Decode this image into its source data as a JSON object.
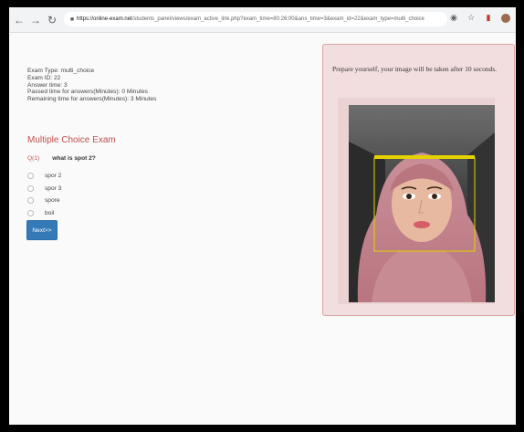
{
  "browser": {
    "url_host": "https://online-exam.net",
    "url_path": "/students_panel/views/exam_active_link.php?exam_time=80:26:00&ans_time=3&exam_id=22&exam_type=multi_choice"
  },
  "exam_info": {
    "type": "Exam Type: multi_choice",
    "id": "Exam ID: 22",
    "answer_time": "Answer time: 3",
    "passed_time": "Passed time for answers(Minutes): 0 Minutes",
    "remaining_time": "Remaining time for answers(Minutes): 3 Minutes"
  },
  "exam": {
    "title": "Multiple Choice Exam",
    "question_number": "Q(1)",
    "question_text": "what is spot 2?",
    "options": [
      "spor 2",
      "spor 3",
      "spore",
      "boil"
    ],
    "next_label": "Next>>"
  },
  "camera": {
    "message": "Prepare yourself, your image will be taken after 10 seconds."
  },
  "colors": {
    "accent": "#c0504d",
    "button": "#337ab7",
    "panel_bg": "#f2dede",
    "face_box": "#e5d300"
  },
  "icons": [
    "back-icon",
    "forward-icon",
    "reload-icon",
    "lock-icon",
    "extension-icon",
    "star-icon",
    "bookmark-icon",
    "profile-icon"
  ]
}
